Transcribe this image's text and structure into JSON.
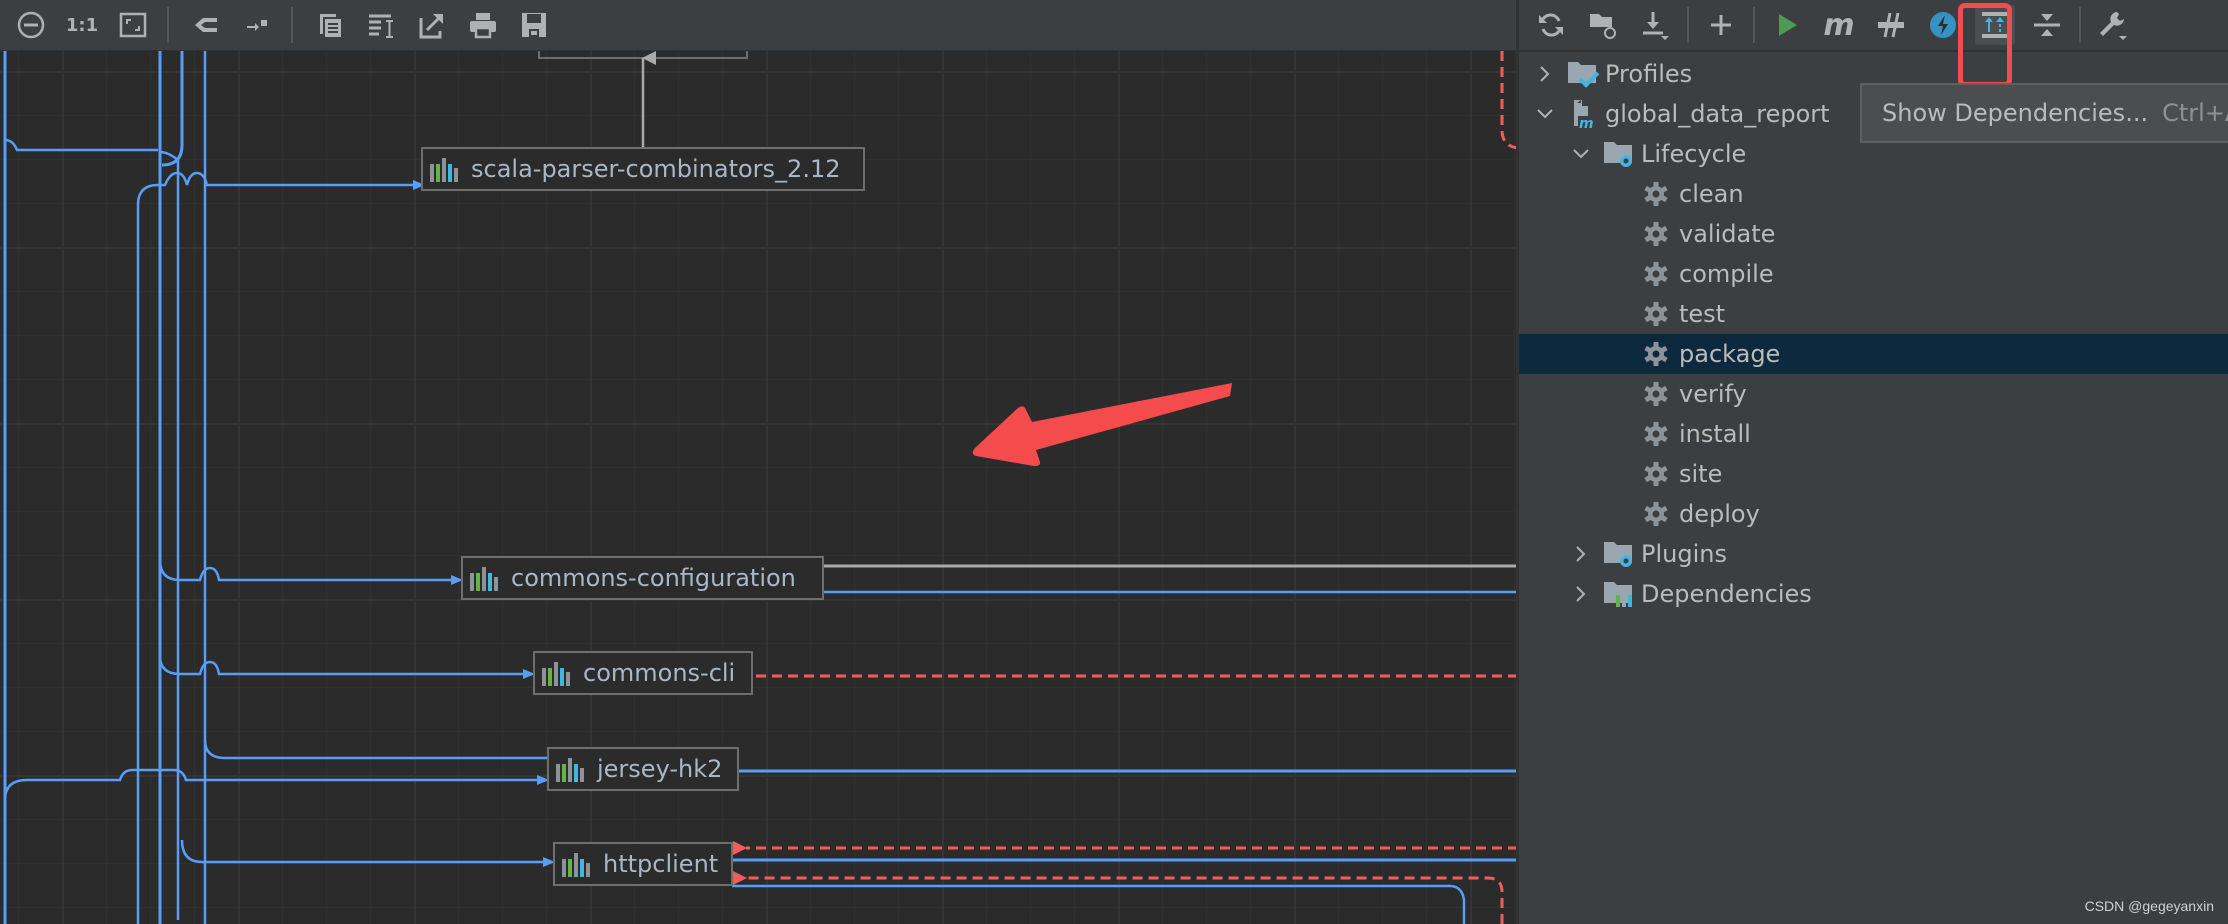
{
  "left_toolbar": {
    "buttons": [
      {
        "name": "zoom-out",
        "icon": "minus-circle-icon"
      },
      {
        "name": "actual-size",
        "icon": "one-to-one-icon",
        "label": "1:1"
      },
      {
        "name": "fit-content",
        "icon": "fit-content-icon"
      },
      {
        "name": "layout",
        "icon": "hierarchy-icon"
      },
      {
        "name": "route-edges",
        "icon": "route-edges-icon"
      },
      {
        "name": "copy",
        "icon": "copy-icon"
      },
      {
        "name": "edit-label",
        "icon": "text-edit-icon"
      },
      {
        "name": "export",
        "icon": "export-icon"
      },
      {
        "name": "print",
        "icon": "print-icon"
      },
      {
        "name": "save",
        "icon": "save-icon"
      }
    ]
  },
  "graph": {
    "nodes": [
      {
        "id": "scala-parser",
        "label": "scala-parser-combinators_2.12"
      },
      {
        "id": "commons-configuration",
        "label": "commons-configuration"
      },
      {
        "id": "commons-cli",
        "label": "commons-cli"
      },
      {
        "id": "jersey-hk2",
        "label": "jersey-hk2"
      },
      {
        "id": "httpclient",
        "label": "httpclient"
      }
    ],
    "colors": {
      "compile_edge": "#589df6",
      "conflict_edge": "#f45c5c",
      "test_edge": "#aaaaaa",
      "annotation": "#f44c4c"
    }
  },
  "right_toolbar": {
    "buttons": [
      {
        "name": "reload",
        "icon": "reload-icon"
      },
      {
        "name": "generate-sources",
        "icon": "folder-reload-icon"
      },
      {
        "name": "download",
        "icon": "download-icon"
      },
      {
        "name": "add",
        "icon": "plus-icon"
      },
      {
        "name": "run",
        "icon": "run-icon"
      },
      {
        "name": "execute-goal",
        "icon": "maven-m-icon"
      },
      {
        "name": "toggle-offline",
        "icon": "offline-icon"
      },
      {
        "name": "skip-tests",
        "icon": "lightning-icon"
      },
      {
        "name": "show-dependencies",
        "icon": "show-dependencies-icon",
        "active": true
      },
      {
        "name": "collapse-all",
        "icon": "collapse-all-icon"
      },
      {
        "name": "settings",
        "icon": "wrench-icon"
      }
    ],
    "tooltip": {
      "text": "Show Dependencies...",
      "shortcut": "Ctrl+Al"
    }
  },
  "tree": {
    "profiles": "Profiles",
    "project": "global_data_report",
    "lifecycle": "Lifecycle",
    "goals": [
      "clean",
      "validate",
      "compile",
      "test",
      "package",
      "verify",
      "install",
      "site",
      "deploy"
    ],
    "selected_goal": "package",
    "plugins": "Plugins",
    "dependencies": "Dependencies"
  },
  "watermark": "CSDN @gegeyanxin"
}
